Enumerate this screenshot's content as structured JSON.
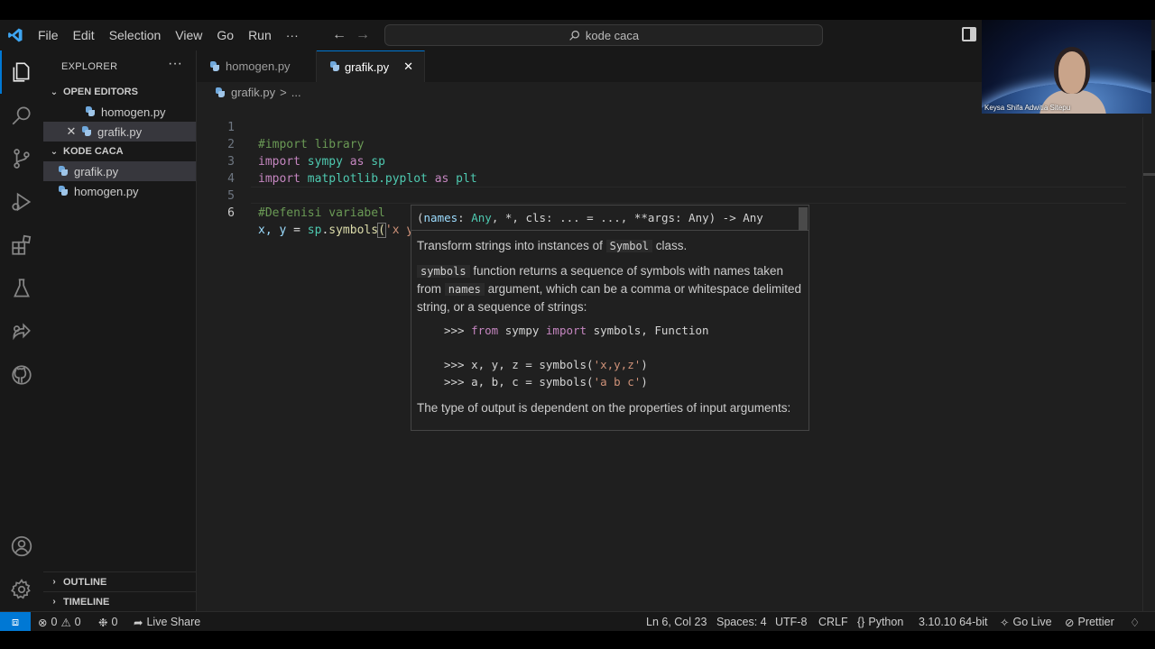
{
  "titlebar": {
    "menu": [
      "File",
      "Edit",
      "Selection",
      "View",
      "Go",
      "Run",
      "···"
    ],
    "search_text": "kode caca"
  },
  "sidebar": {
    "title": "EXPLORER",
    "more": "···",
    "open_editors_header": "OPEN EDITORS",
    "open_editors": [
      "homogen.py",
      "grafik.py"
    ],
    "folder_header": "KODE CACA",
    "files": [
      "grafik.py",
      "homogen.py"
    ],
    "outline_header": "OUTLINE",
    "timeline_header": "TIMELINE"
  },
  "tabs": [
    {
      "label": "homogen.py"
    },
    {
      "label": "grafik.py"
    }
  ],
  "breadcrumb": {
    "file": "grafik.py",
    "sep": ">",
    "more": "..."
  },
  "code": {
    "line_numbers": [
      "1",
      "2",
      "3",
      "4",
      "5",
      "6"
    ],
    "l1": "#import library",
    "l2_kw": "import",
    "l2_mod": "sympy",
    "l2_as": "as",
    "l2_alias": "sp",
    "l3_kw": "import",
    "l3_mod": "matplotlib.pyplot",
    "l3_as": "as",
    "l3_alias": "plt",
    "l5": "#Defenisi variabel",
    "l6_vars": "x, y",
    "l6_eq": " = ",
    "l6_obj": "sp",
    "l6_dot": ".",
    "l6_fn": "symbols",
    "l6_open": "(",
    "l6_str": "'x y'",
    "l6_close": ")"
  },
  "hover": {
    "sig_open": "(",
    "sig_names": "names",
    "sig_colon": ": ",
    "sig_any1": "Any",
    "sig_rest": ", *, cls: ... = ..., **args: Any) -> Any",
    "p1_a": "Transform strings into instances of ",
    "p1_code": "Symbol",
    "p1_b": " class.",
    "p2_code1": "symbols",
    "p2_a": " function returns a sequence of symbols with names taken from ",
    "p2_code2": "names",
    "p2_b": " argument, which can be a comma or whitespace delimited string, or a sequence of strings:",
    "ex1_prompt": ">>> ",
    "ex1_from": "from",
    "ex1_mod": " sympy ",
    "ex1_import": "import",
    "ex1_rest": " symbols, Function",
    "ex2_a": ">>> x, y, z = symbols(",
    "ex2_s": "'x,y,z'",
    "ex2_b": ")",
    "ex3_a": ">>> a, b, c = symbols(",
    "ex3_s": "'a b c'",
    "ex3_b": ")",
    "p3": "The type of output is dependent on the properties of input arguments:"
  },
  "statusbar": {
    "errors": "0",
    "warnings": "0",
    "ports": "0",
    "live_share": "Live Share",
    "position": "Ln 6, Col 23",
    "spaces": "Spaces: 4",
    "encoding": "UTF-8",
    "eol": "CRLF",
    "language": "Python",
    "interpreter": "3.10.10 64-bit",
    "go_live": "Go Live",
    "prettier": "Prettier"
  },
  "webcam": {
    "name": "Keysa Shifa Adwitia Sitepu"
  }
}
